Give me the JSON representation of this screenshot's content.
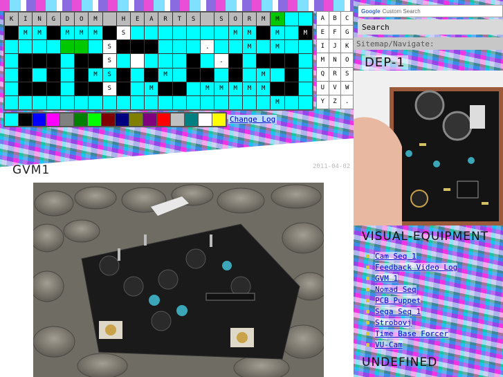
{
  "grid": {
    "rows": [
      [
        [
          "K",
          "gr"
        ],
        [
          "I",
          "gr"
        ],
        [
          "N",
          "gr"
        ],
        [
          "G",
          "gr"
        ],
        [
          "D",
          "gr"
        ],
        [
          "O",
          "gr"
        ],
        [
          "M",
          "gr"
        ],
        [
          "",
          "gr"
        ],
        [
          "H",
          "gr"
        ],
        [
          "E",
          "gr"
        ],
        [
          "A",
          "gr"
        ],
        [
          "R",
          "gr"
        ],
        [
          "T",
          "gr"
        ],
        [
          "S",
          "gr"
        ],
        [
          "",
          "gr"
        ],
        [
          "S",
          "gr"
        ],
        [
          "O",
          "gr"
        ],
        [
          "R",
          "gr"
        ],
        [
          "M",
          "gr"
        ],
        [
          "M",
          "g"
        ],
        [
          "",
          "cy"
        ],
        [
          "",
          "cy"
        ]
      ],
      [
        [
          "",
          "bk"
        ],
        [
          "M",
          "cy"
        ],
        [
          "M",
          "cy"
        ],
        [
          "",
          "bk"
        ],
        [
          "M",
          "cy"
        ],
        [
          "M",
          "cy"
        ],
        [
          "M",
          "cy"
        ],
        [
          "",
          "bk"
        ],
        [
          "S",
          "wh"
        ],
        [
          "",
          "cy"
        ],
        [
          "",
          "cy"
        ],
        [
          "",
          "cy"
        ],
        [
          "",
          "cy"
        ],
        [
          "",
          "cy"
        ],
        [
          "",
          "cy"
        ],
        [
          "",
          "cy"
        ],
        [
          "M",
          "cy"
        ],
        [
          "M",
          "cy"
        ],
        [
          "",
          "bk"
        ],
        [
          "M",
          "cy"
        ],
        [
          "",
          "cy"
        ],
        [
          "M",
          "bk"
        ]
      ],
      [
        [
          "",
          "cy"
        ],
        [
          "",
          "cy"
        ],
        [
          "",
          "cy"
        ],
        [
          "",
          "cy"
        ],
        [
          "",
          "g"
        ],
        [
          "",
          "g"
        ],
        [
          "",
          "cy"
        ],
        [
          "S",
          "wh"
        ],
        [
          "",
          "bk"
        ],
        [
          "",
          "bk"
        ],
        [
          "",
          "bk"
        ],
        [
          "",
          "cy"
        ],
        [
          "",
          "cy"
        ],
        [
          "",
          "cy"
        ],
        [
          ".",
          "wh"
        ],
        [
          "",
          "cy"
        ],
        [
          "",
          "cy"
        ],
        [
          "M",
          "cy"
        ],
        [
          "",
          "cy"
        ],
        [
          "M",
          "cy"
        ],
        [
          "",
          "cy"
        ],
        [
          "",
          "cy"
        ]
      ],
      [
        [
          "",
          "cy"
        ],
        [
          "",
          "bk"
        ],
        [
          "",
          "bk"
        ],
        [
          "",
          "bk"
        ],
        [
          "",
          "cy"
        ],
        [
          "",
          "bk"
        ],
        [
          "",
          "bk"
        ],
        [
          "S",
          "wh"
        ],
        [
          "",
          "cy"
        ],
        [
          "",
          "wh"
        ],
        [
          "",
          "cy"
        ],
        [
          "",
          "cy"
        ],
        [
          "",
          "cy"
        ],
        [
          "",
          "bk"
        ],
        [
          "",
          "cy"
        ],
        [
          ".",
          "wh"
        ],
        [
          "",
          "bk"
        ],
        [
          "",
          "cy"
        ],
        [
          "",
          "bk"
        ],
        [
          "",
          "bk"
        ],
        [
          "",
          "bk"
        ],
        [
          "",
          "cy"
        ]
      ],
      [
        [
          "",
          "cy"
        ],
        [
          "",
          "bk"
        ],
        [
          "",
          "cy"
        ],
        [
          "",
          "bk"
        ],
        [
          "",
          "cy"
        ],
        [
          "",
          "bk"
        ],
        [
          "M",
          "cy"
        ],
        [
          "S",
          "cy"
        ],
        [
          "",
          "bk"
        ],
        [
          "",
          "cy"
        ],
        [
          "",
          "bk"
        ],
        [
          "M",
          "cy"
        ],
        [
          "",
          "cy"
        ],
        [
          "",
          "bk"
        ],
        [
          "",
          "bk"
        ],
        [
          "",
          "cy"
        ],
        [
          "",
          "bk"
        ],
        [
          "",
          "cy"
        ],
        [
          "M",
          "cy"
        ],
        [
          "",
          "cy"
        ],
        [
          "",
          "bk"
        ],
        [
          "",
          "cy"
        ]
      ],
      [
        [
          "",
          "cy"
        ],
        [
          "",
          "bk"
        ],
        [
          "",
          "bk"
        ],
        [
          "",
          "bk"
        ],
        [
          "",
          "cy"
        ],
        [
          "",
          "bk"
        ],
        [
          "",
          "bk"
        ],
        [
          "S",
          "wh"
        ],
        [
          "",
          "bk"
        ],
        [
          "",
          "cy"
        ],
        [
          "M",
          "cy"
        ],
        [
          "",
          "bk"
        ],
        [
          "",
          "bk"
        ],
        [
          "",
          "cy"
        ],
        [
          "M",
          "cy"
        ],
        [
          "M",
          "cy"
        ],
        [
          "M",
          "cy"
        ],
        [
          "M",
          "cy"
        ],
        [
          "M",
          "cy"
        ],
        [
          "",
          "bk"
        ],
        [
          "",
          "bk"
        ],
        [
          "",
          "cy"
        ]
      ],
      [
        [
          "",
          "cy"
        ],
        [
          "",
          "cy"
        ],
        [
          "",
          "cy"
        ],
        [
          "",
          "cy"
        ],
        [
          "",
          "cy"
        ],
        [
          "",
          "cy"
        ],
        [
          "",
          "cy"
        ],
        [
          "",
          "cy"
        ],
        [
          "",
          "cy"
        ],
        [
          "",
          "cy"
        ],
        [
          "",
          "cy"
        ],
        [
          "",
          "cy"
        ],
        [
          "",
          "cy"
        ],
        [
          "",
          "cy"
        ],
        [
          "",
          "cy"
        ],
        [
          "",
          "cy"
        ],
        [
          "",
          "cy"
        ],
        [
          "",
          "cy"
        ],
        [
          "",
          "cy"
        ],
        [
          "M",
          "cy"
        ],
        [
          "",
          "cy"
        ],
        [
          "",
          "cy"
        ]
      ]
    ]
  },
  "palette": [
    "#00ffff",
    "#000000",
    "#0000ff",
    "#ff00ff",
    "#808080",
    "#008000",
    "#00ff00",
    "#800000",
    "#000080",
    "#808000",
    "#800080",
    "#ff0000",
    "#c0c0c0",
    "#008080",
    "#ffffff",
    "#ffff00"
  ],
  "change_log": "Change Log",
  "keys": [
    "A",
    "B",
    "C",
    "E",
    "F",
    "G",
    "I",
    "J",
    "K",
    "M",
    "N",
    "O",
    "Q",
    "R",
    "S",
    "U",
    "V",
    "W",
    "Y",
    "Z",
    "."
  ],
  "sidebar": {
    "search_google": "Google",
    "search_placeholder": "Custom Search",
    "search_button": "Search",
    "sitemap": "Sitemap/Navigate:",
    "dep_title": "DEP-1",
    "visual_title": "VISUAL-EQUIPMENT",
    "visual_items": [
      "Cam Seq 1",
      "Feedback Video Log",
      "GVM 1",
      "Nomad Seq",
      "PCB Puppet",
      "Sega Seq 1",
      "Strobovj",
      "Time Base Forcer",
      "VU-Cam"
    ],
    "undef_title": "UNDEFINED"
  },
  "post": {
    "title": "GVM1",
    "date": "2011-04-02"
  },
  "colors": {
    "link": "#0000cc",
    "accent": "#00ffff"
  }
}
